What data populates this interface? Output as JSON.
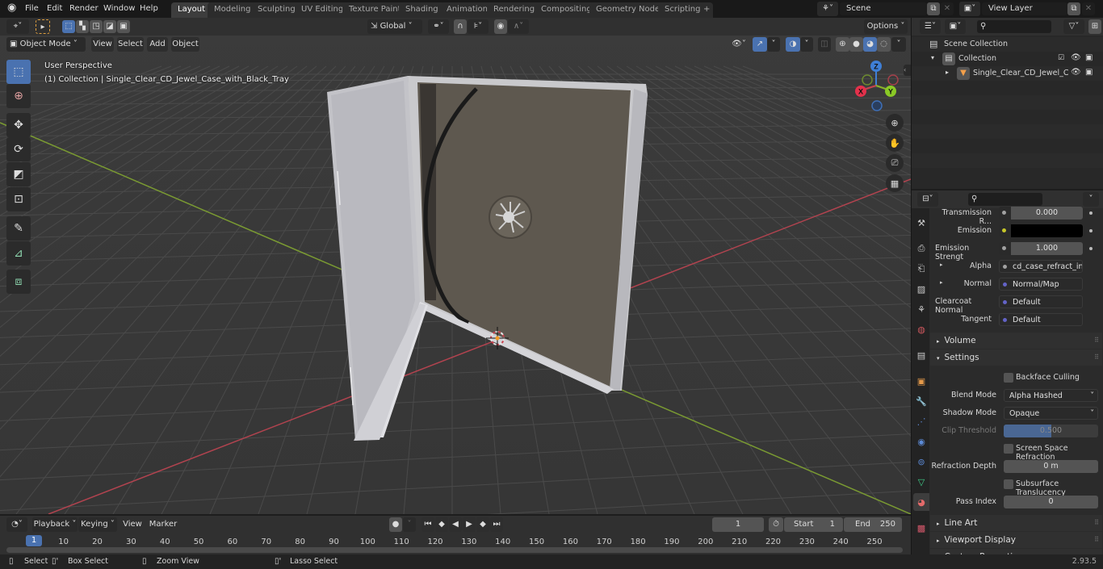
{
  "app": {
    "version": "2.93.5"
  },
  "menu": {
    "items": [
      "File",
      "Edit",
      "Render",
      "Window",
      "Help"
    ]
  },
  "workspaces": {
    "tabs": [
      "Layout",
      "Modeling",
      "Sculpting",
      "UV Editing",
      "Texture Paint",
      "Shading",
      "Animation",
      "Rendering",
      "Compositing",
      "Geometry Nodes",
      "Scripting"
    ],
    "active": "Layout",
    "add_label": "+"
  },
  "scene": {
    "name": "Scene",
    "view_layer": "View Layer"
  },
  "tool_header": {
    "orientation": "Global",
    "options_label": "Options"
  },
  "viewport_header": {
    "mode": "Object Mode",
    "menus": [
      "View",
      "Select",
      "Add",
      "Object"
    ]
  },
  "viewport": {
    "perspective_label": "User Perspective",
    "collection_label": "(1) Collection | Single_Clear_CD_Jewel_Case_with_Black_Tray",
    "gizmo": {
      "x": "X",
      "y": "Y",
      "z": "Z"
    },
    "axis_colors": {
      "x": "#c8434f",
      "y": "#8ab329",
      "z": "#3f7fd6"
    }
  },
  "toolbar": {
    "tools": [
      "select-box",
      "cursor",
      "move",
      "rotate",
      "scale",
      "transform",
      "annotate",
      "measure",
      "add-cube"
    ],
    "active": "select-box"
  },
  "outliner": {
    "search_placeholder": "",
    "root": "Scene Collection",
    "items": [
      {
        "label": "Collection",
        "type": "collection",
        "expanded": true
      },
      {
        "label": "Single_Clear_CD_Jewel_C",
        "type": "mesh",
        "expanded": false
      }
    ]
  },
  "properties": {
    "search_placeholder": "",
    "rows": [
      {
        "label": "Transmission R...",
        "value": "0.000",
        "socket_color": "#a1a1a1",
        "kind": "number"
      },
      {
        "label": "Emission",
        "value": "",
        "socket_color": "#c7c729",
        "kind": "color",
        "color": "#000000"
      },
      {
        "label": "Emission Strengt",
        "value": "1.000",
        "socket_color": "#a1a1a1",
        "kind": "number"
      },
      {
        "label": "Alpha",
        "value": "cd_case_refract_inv...",
        "socket_color": "#a1a1a1",
        "kind": "link",
        "expandable": true
      },
      {
        "label": "Normal",
        "value": "Normal/Map",
        "socket_color": "#6363c7",
        "kind": "link",
        "expandable": true
      },
      {
        "label": "Clearcoat Normal",
        "value": "Default",
        "socket_color": "#6363c7",
        "kind": "link"
      },
      {
        "label": "Tangent",
        "value": "Default",
        "socket_color": "#6363c7",
        "kind": "link"
      }
    ],
    "panels": {
      "volume": "Volume",
      "settings": "Settings",
      "line_art": "Line Art",
      "viewport_display": "Viewport Display",
      "custom_properties": "Custom Properties"
    },
    "settings": {
      "backface_culling": {
        "label": "Backface Culling",
        "checked": false
      },
      "blend_mode": {
        "label": "Blend Mode",
        "value": "Alpha Hashed"
      },
      "shadow_mode": {
        "label": "Shadow Mode",
        "value": "Opaque"
      },
      "clip_threshold": {
        "label": "Clip Threshold",
        "value": "0.500",
        "fraction": 0.5
      },
      "screen_space_refraction": {
        "label": "Screen Space Refraction",
        "checked": false
      },
      "refraction_depth": {
        "label": "Refraction Depth",
        "value": "0 m"
      },
      "subsurface_translucency": {
        "label": "Subsurface Translucency",
        "checked": false
      },
      "pass_index": {
        "label": "Pass Index",
        "value": "0"
      }
    }
  },
  "timeline": {
    "menus": [
      "Playback",
      "Keying",
      "View",
      "Marker"
    ],
    "current_frame": "1",
    "start_label": "Start",
    "start": "1",
    "end_label": "End",
    "end": "250",
    "ticks": [
      "10",
      "20",
      "30",
      "40",
      "50",
      "60",
      "70",
      "80",
      "90",
      "100",
      "110",
      "120",
      "130",
      "140",
      "150",
      "160",
      "170",
      "180",
      "190",
      "200",
      "210",
      "220",
      "230",
      "240",
      "250"
    ],
    "playhead": "1"
  },
  "statusbar": {
    "items": [
      "Select",
      "Box Select",
      "Zoom View",
      "Lasso Select"
    ]
  }
}
